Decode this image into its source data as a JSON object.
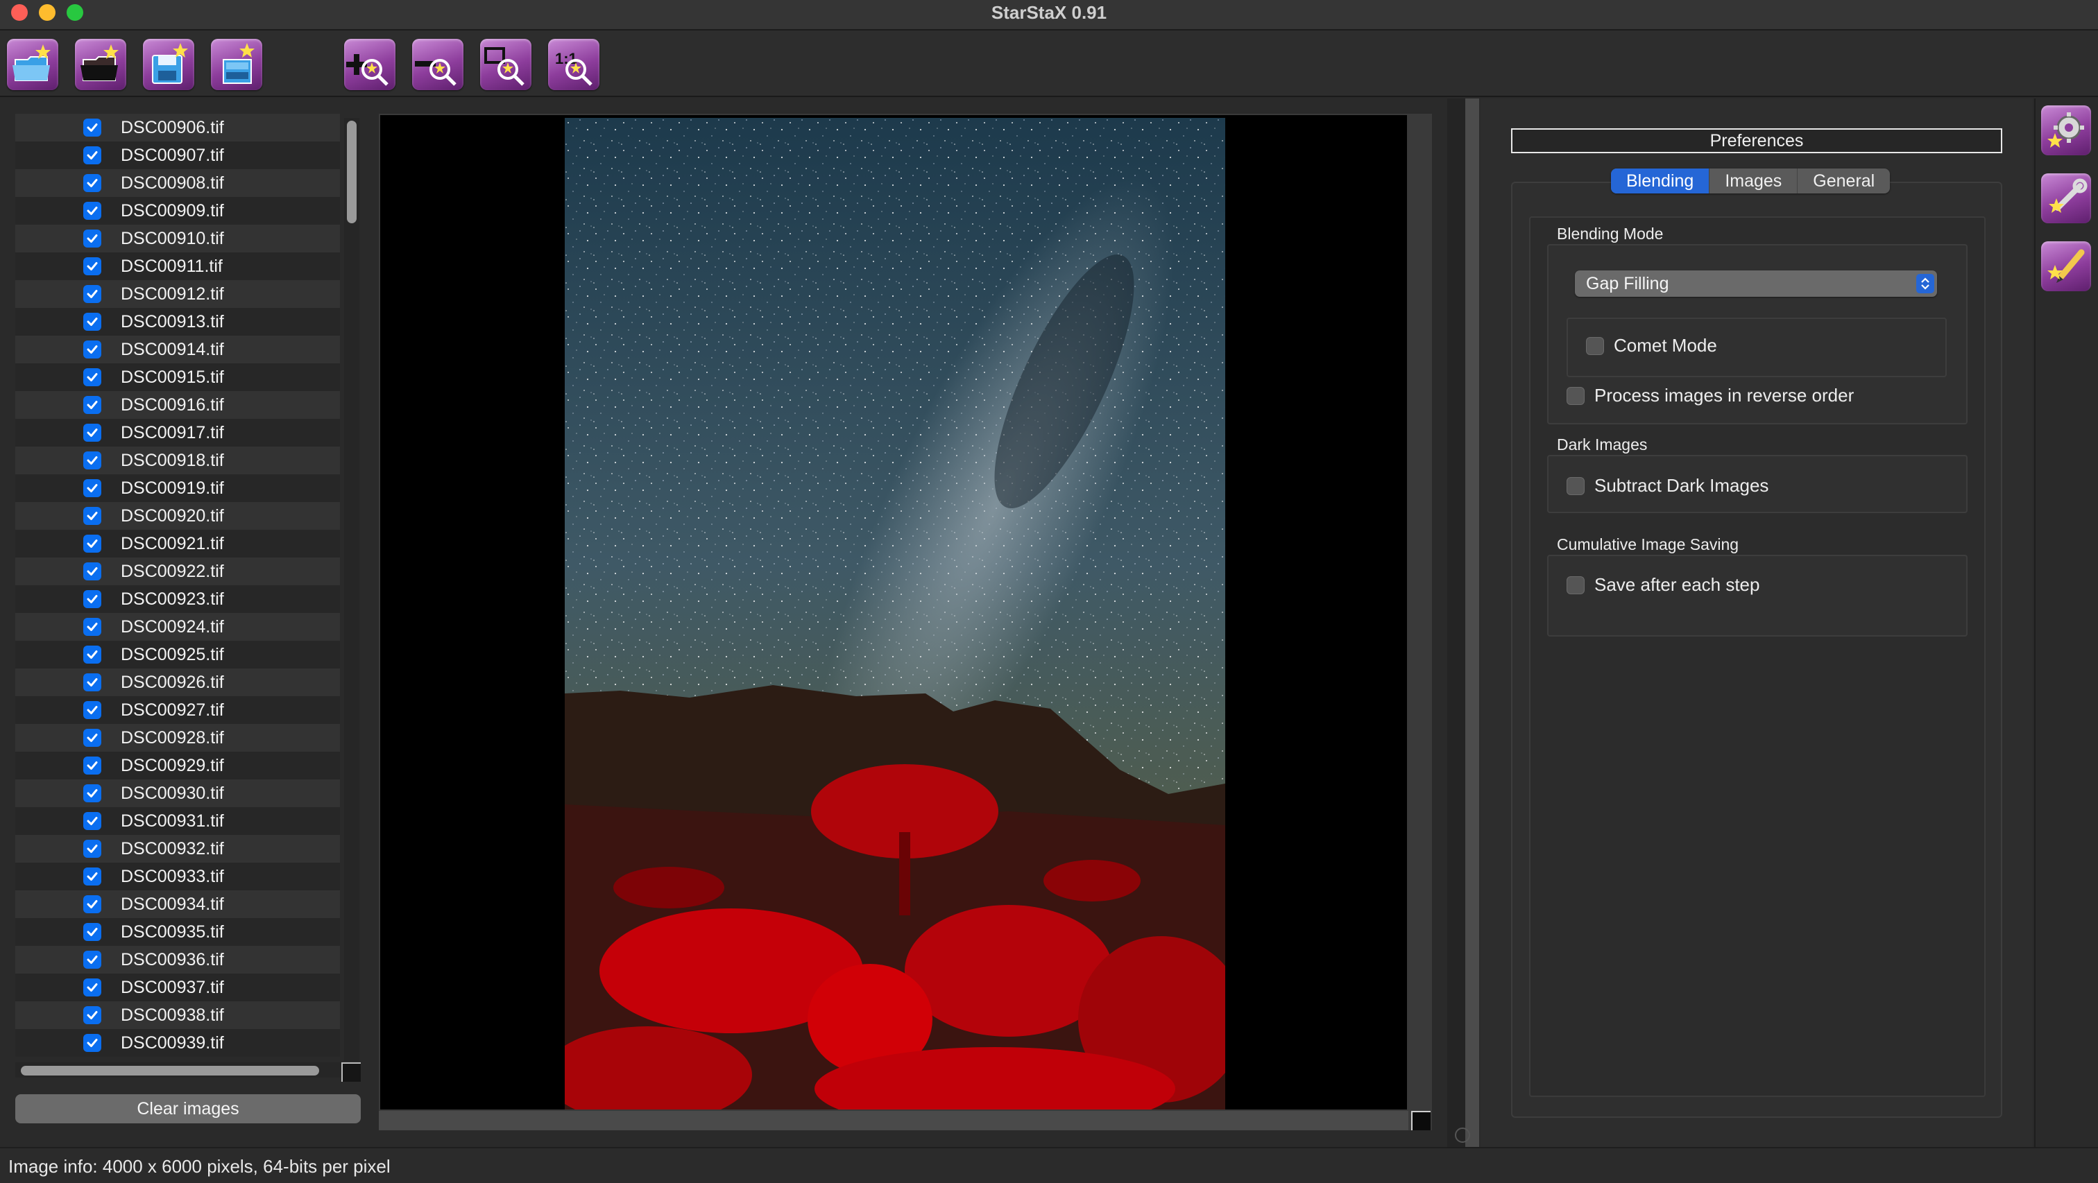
{
  "window": {
    "title": "StarStaX 0.91"
  },
  "toolbar": {
    "buttons": [
      {
        "name": "open-images",
        "icon": "folder-open-icon"
      },
      {
        "name": "open-dark-images",
        "icon": "dark-frame-icon"
      },
      {
        "name": "save-image",
        "icon": "save-disk-icon"
      },
      {
        "name": "save-as",
        "icon": "save-stack-icon"
      },
      {
        "name": "zoom-in",
        "icon": "zoom-in-icon"
      },
      {
        "name": "zoom-out",
        "icon": "zoom-out-icon"
      },
      {
        "name": "fit-to-window",
        "icon": "fit-window-icon"
      },
      {
        "name": "actual-size",
        "icon": "actual-size-icon",
        "label": "1:1"
      }
    ]
  },
  "files": [
    "DSC00906.tif",
    "DSC00907.tif",
    "DSC00908.tif",
    "DSC00909.tif",
    "DSC00910.tif",
    "DSC00911.tif",
    "DSC00912.tif",
    "DSC00913.tif",
    "DSC00914.tif",
    "DSC00915.tif",
    "DSC00916.tif",
    "DSC00917.tif",
    "DSC00918.tif",
    "DSC00919.tif",
    "DSC00920.tif",
    "DSC00921.tif",
    "DSC00922.tif",
    "DSC00923.tif",
    "DSC00924.tif",
    "DSC00925.tif",
    "DSC00926.tif",
    "DSC00927.tif",
    "DSC00928.tif",
    "DSC00929.tif",
    "DSC00930.tif",
    "DSC00931.tif",
    "DSC00932.tif",
    "DSC00933.tif",
    "DSC00934.tif",
    "DSC00935.tif",
    "DSC00936.tif",
    "DSC00937.tif",
    "DSC00938.tif",
    "DSC00939.tif"
  ],
  "left": {
    "clear_label": "Clear images"
  },
  "prefs": {
    "title": "Preferences",
    "tabs": [
      "Blending",
      "Images",
      "General"
    ],
    "active_tab": "Blending",
    "blending_mode_label": "Blending Mode",
    "blending_mode_value": "Gap Filling",
    "comet_mode_label": "Comet Mode",
    "comet_mode_checked": false,
    "reverse_label": "Process images in reverse order",
    "reverse_checked": false,
    "dark_images_label": "Dark Images",
    "subtract_dark_label": "Subtract Dark Images",
    "subtract_dark_checked": false,
    "cumulative_label": "Cumulative Image Saving",
    "save_each_label": "Save after each step",
    "save_each_checked": false
  },
  "sidebar": {
    "buttons": [
      {
        "name": "preferences",
        "icon": "gear-icon"
      },
      {
        "name": "settings",
        "icon": "wrench-icon"
      },
      {
        "name": "edit",
        "icon": "pencil-icon"
      }
    ]
  },
  "status": {
    "text": "Image info: 4000 x 6000 pixels, 64-bits per pixel"
  },
  "colors": {
    "accent": "#2566d6",
    "checkbox": "#0a6ef0",
    "toolbar_icon": "#8d3d9c"
  }
}
